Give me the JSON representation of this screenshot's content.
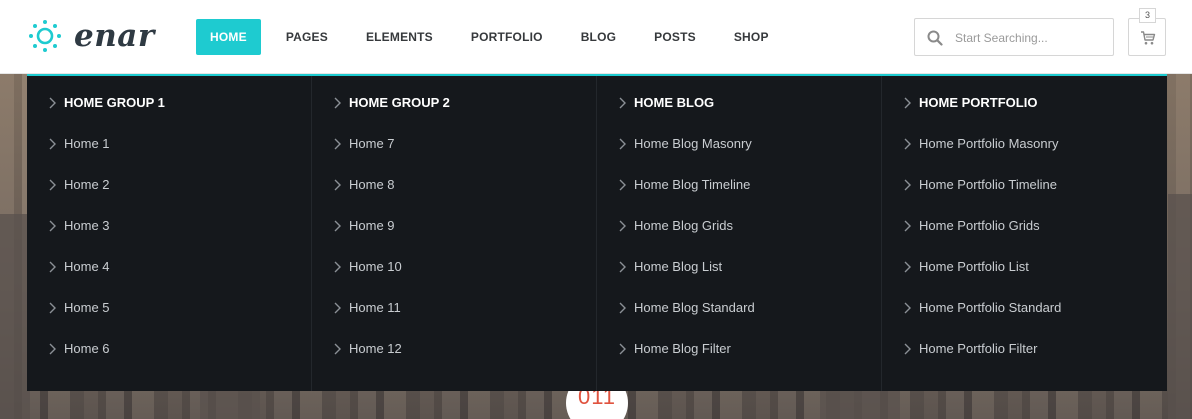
{
  "brand": {
    "name": "enar",
    "accent": "#1ecbd0"
  },
  "nav": {
    "items": [
      {
        "label": "HOME",
        "active": true
      },
      {
        "label": "PAGES"
      },
      {
        "label": "ELEMENTS"
      },
      {
        "label": "PORTFOLIO"
      },
      {
        "label": "BLOG"
      },
      {
        "label": "POSTS"
      },
      {
        "label": "SHOP"
      }
    ]
  },
  "search": {
    "placeholder": "Start Searching...",
    "icon": "search-icon"
  },
  "cart": {
    "count": "3",
    "icon": "cart-icon"
  },
  "mega_menu": {
    "columns": [
      {
        "heading": "HOME GROUP 1",
        "items": [
          "Home 1",
          "Home 2",
          "Home 3",
          "Home 4",
          "Home 5",
          "Home 6"
        ]
      },
      {
        "heading": "HOME GROUP 2",
        "items": [
          "Home 7",
          "Home 8",
          "Home 9",
          "Home 10",
          "Home 11",
          "Home 12"
        ]
      },
      {
        "heading": "HOME BLOG",
        "items": [
          "Home Blog Masonry",
          "Home Blog Timeline",
          "Home Blog Grids",
          "Home Blog List",
          "Home Blog Standard",
          "Home Blog Filter"
        ]
      },
      {
        "heading": "HOME PORTFOLIO",
        "items": [
          "Home Portfolio Masonry",
          "Home Portfolio Timeline",
          "Home Portfolio Grids",
          "Home Portfolio List",
          "Home Portfolio Standard",
          "Home Portfolio Filter"
        ]
      }
    ]
  },
  "hero": {
    "badge_text": "011"
  }
}
